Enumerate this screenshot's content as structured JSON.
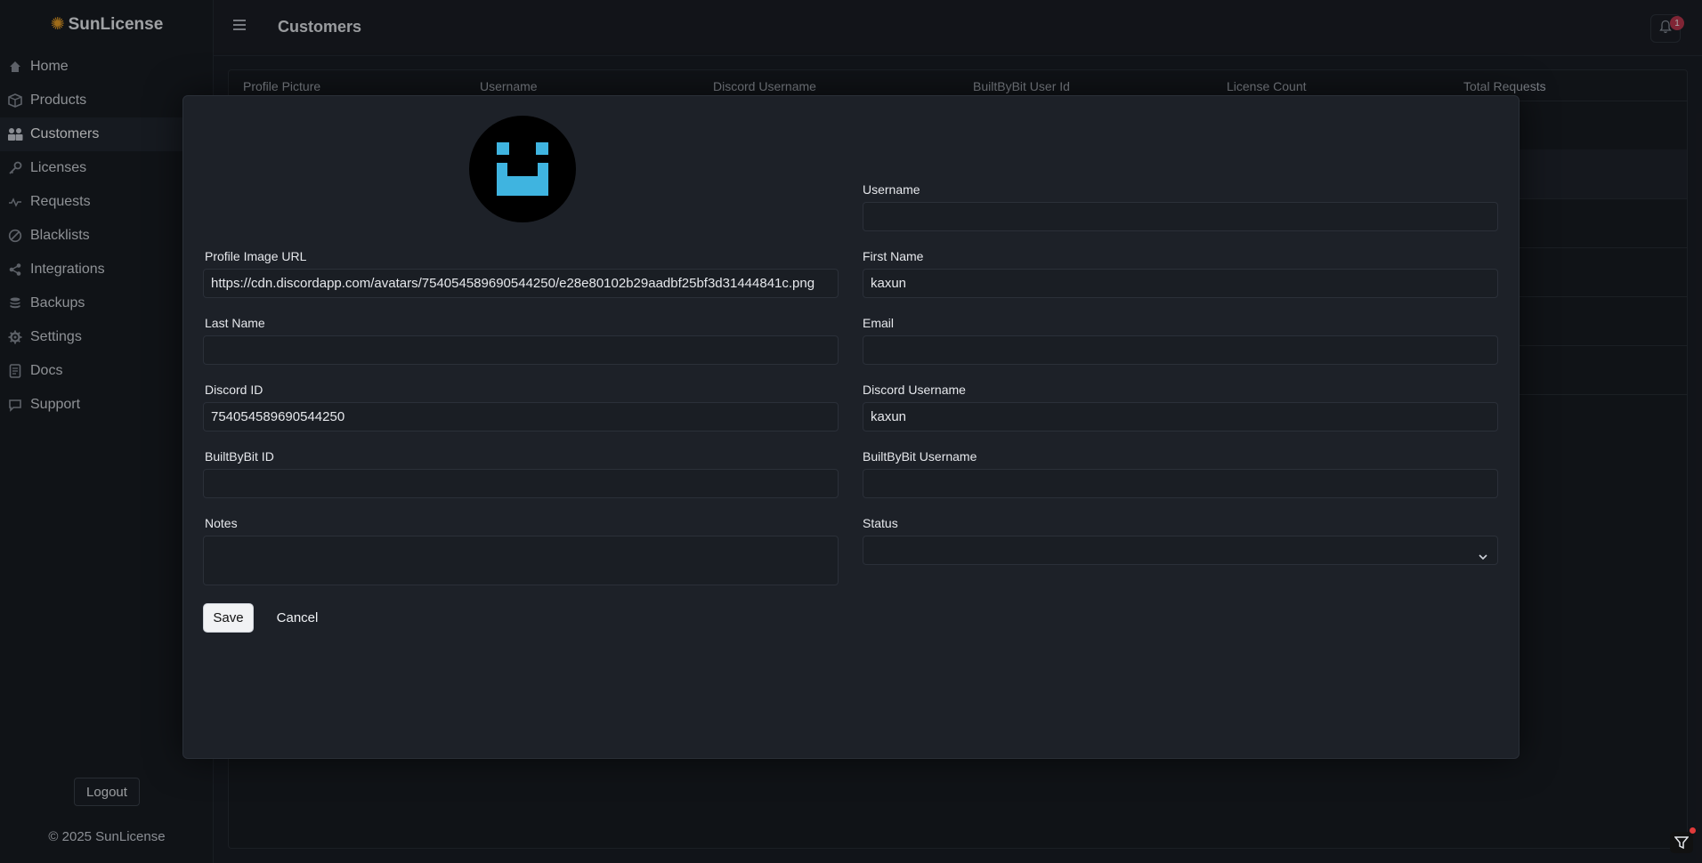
{
  "brand": {
    "name": "SunLicense"
  },
  "sidebar": {
    "items": [
      {
        "label": "Home",
        "icon": "home-icon"
      },
      {
        "label": "Products",
        "icon": "box-icon"
      },
      {
        "label": "Customers",
        "icon": "users-icon",
        "active": true
      },
      {
        "label": "Licenses",
        "icon": "key-icon"
      },
      {
        "label": "Requests",
        "icon": "activity-icon"
      },
      {
        "label": "Blacklists",
        "icon": "ban-icon"
      },
      {
        "label": "Integrations",
        "icon": "share-icon"
      },
      {
        "label": "Backups",
        "icon": "database-icon"
      },
      {
        "label": "Settings",
        "icon": "gear-icon"
      },
      {
        "label": "Docs",
        "icon": "document-icon"
      },
      {
        "label": "Support",
        "icon": "chat-icon"
      }
    ],
    "logout_label": "Logout",
    "copyright": "© 2025 SunLicense"
  },
  "header": {
    "title": "Customers",
    "notification_count": "1"
  },
  "table": {
    "columns": [
      "Profile Picture",
      "Username",
      "Discord Username",
      "BuiltByBit User Id",
      "License Count",
      "Total Requests"
    ]
  },
  "modal": {
    "fields": {
      "username": {
        "label": "Username",
        "value": ""
      },
      "profile_image_url": {
        "label": "Profile Image URL",
        "value": "https://cdn.discordapp.com/avatars/754054589690544250/e28e80102b29aadbf25bf3d31444841c.png"
      },
      "first_name": {
        "label": "First Name",
        "value": "kaxun"
      },
      "last_name": {
        "label": "Last Name",
        "value": ""
      },
      "email": {
        "label": "Email",
        "value": ""
      },
      "discord_id": {
        "label": "Discord ID",
        "value": "754054589690544250"
      },
      "discord_username": {
        "label": "Discord Username",
        "value": "kaxun"
      },
      "builtbybit_id": {
        "label": "BuiltByBit ID",
        "value": ""
      },
      "builtbybit_username": {
        "label": "BuiltByBit Username",
        "value": ""
      },
      "notes": {
        "label": "Notes",
        "value": ""
      },
      "status": {
        "label": "Status",
        "value": ""
      }
    },
    "save_label": "Save",
    "cancel_label": "Cancel"
  },
  "colors": {
    "accent": "#f0a020",
    "avatar_face": "#3fb4e0",
    "badge": "#c0344a"
  }
}
